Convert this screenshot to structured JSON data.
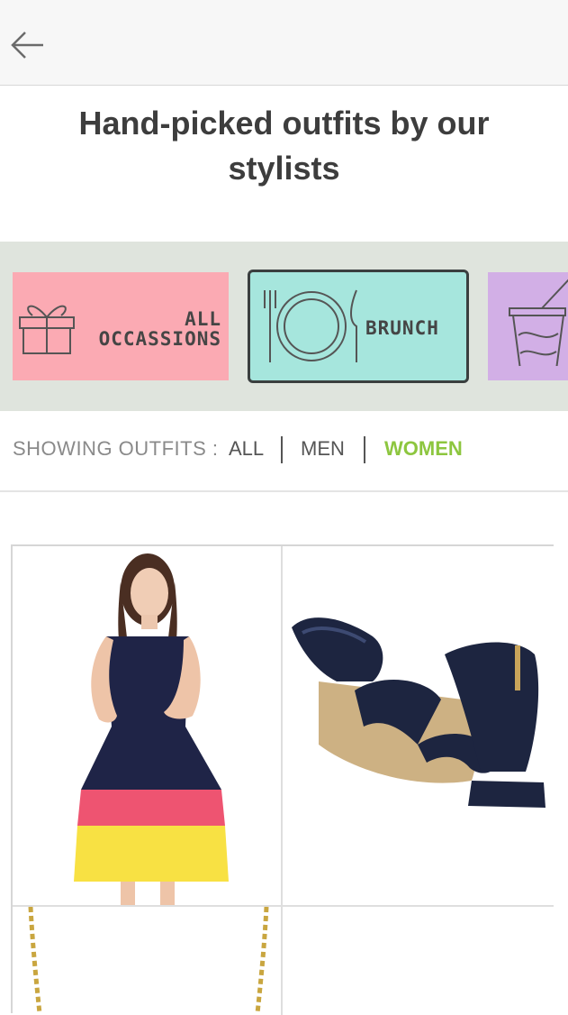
{
  "header": {
    "title": "Hand-picked outfits by our stylists"
  },
  "categories": [
    {
      "label_line1": "ALL",
      "label_line2": "OCCASSIONS",
      "icon": "gift-icon",
      "color": "#fbaab3",
      "selected": false
    },
    {
      "label": "BRUNCH",
      "icon": "plate-cutlery-icon",
      "color": "#a6e6dd",
      "selected": true
    },
    {
      "label": "",
      "icon": "drink-cup-icon",
      "color": "#d2afe6",
      "selected": false
    }
  ],
  "filter": {
    "label": "SHOWING OUTFITS :",
    "options": [
      "ALL",
      "MEN",
      "WOMEN"
    ],
    "active": "WOMEN",
    "active_color": "#8dc63f"
  },
  "outfits": [
    {
      "item": "dress",
      "image": "dress-image"
    },
    {
      "item": "sandals",
      "image": "sandals-image"
    },
    {
      "item": "necklace",
      "image": "necklace-image"
    },
    {
      "item": "empty",
      "image": ""
    }
  ]
}
